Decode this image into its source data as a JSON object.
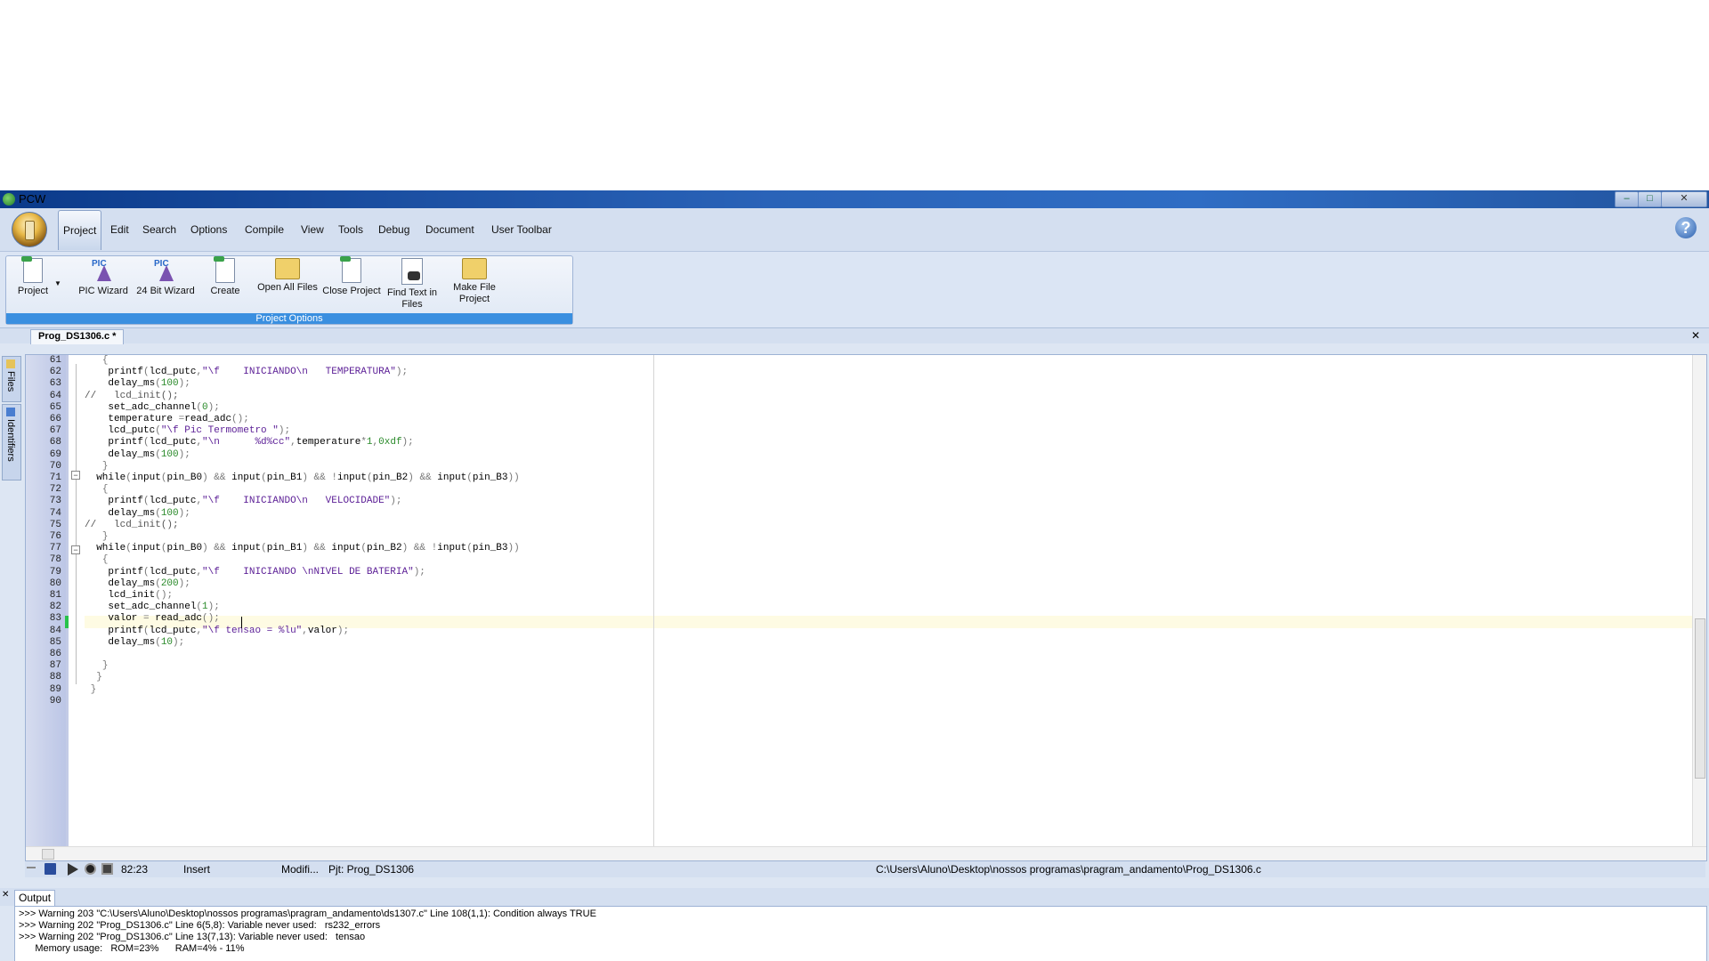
{
  "window": {
    "title": "PCW"
  },
  "menu": {
    "tabs": [
      "Project",
      "Edit",
      "Search",
      "Options",
      "Compile",
      "View",
      "Tools",
      "Debug",
      "Document",
      "User Toolbar"
    ]
  },
  "ribbon": {
    "group_label": "Project Options",
    "buttons": {
      "project": "Project",
      "pic_wizard": "PIC Wizard",
      "bit24_wizard": "24 Bit Wizard",
      "create": "Create",
      "open_all": "Open All Files",
      "close_project": "Close Project",
      "find_text_1": "Find Text in",
      "find_text_2": "Files",
      "make_file_1": "Make File",
      "make_file_2": "Project"
    },
    "pic_badge": "PIC"
  },
  "document": {
    "tab": "Prog_DS1306.c *"
  },
  "side_tabs": {
    "files": "Files",
    "identifiers": "Identifiers"
  },
  "editor": {
    "line_numbers": [
      "61",
      "62",
      "63",
      "64",
      "65",
      "66",
      "67",
      "68",
      "69",
      "70",
      "71",
      "72",
      "73",
      "74",
      "75",
      "76",
      "77",
      "78",
      "79",
      "80",
      "81",
      "82",
      "83",
      "84",
      "85",
      "86",
      "87",
      "88",
      "89",
      "90"
    ],
    "lines": [
      "   {",
      "    printf(lcd_putc,\"\\f    INICIANDO\\n   TEMPERATURA\");",
      "    delay_ms(100);",
      "//   lcd_init();",
      "    set_adc_channel(0);",
      "    temperature =read_adc();",
      "    lcd_putc(\"\\f Pic Termometro \");",
      "    printf(lcd_putc,\"\\n      %d%cc\",temperature*1,0xdf);",
      "    delay_ms(100);",
      "   }",
      "  while(input(pin_B0) && input(pin_B1) && !input(pin_B2) && input(pin_B3))",
      "   {",
      "    printf(lcd_putc,\"\\f    INICIANDO\\n   VELOCIDADE\");",
      "    delay_ms(100);",
      "//   lcd_init();",
      "   }",
      "  while(input(pin_B0) && input(pin_B1) && input(pin_B2) && !input(pin_B3))",
      "   {",
      "    printf(lcd_putc,\"\\f    INICIANDO \\nNIVEL DE BATERIA\");",
      "    delay_ms(200);",
      "    lcd_init();",
      "    set_adc_channel(1);",
      "    valor = read_adc();",
      "    printf(lcd_putc,\"\\f tensao = %lu\",valor);",
      "    delay_ms(10);",
      "",
      "   }",
      "  }",
      " }",
      ""
    ]
  },
  "status": {
    "position": "82:23",
    "mode": "Insert",
    "modified": "Modifi...",
    "project": "Pjt: Prog_DS1306",
    "path": "C:\\Users\\Aluno\\Desktop\\nossos programas\\pragram_andamento\\Prog_DS1306.c"
  },
  "output": {
    "tab": "Output",
    "lines": [
      ">>> Warning 203 \"C:\\Users\\Aluno\\Desktop\\nossos programas\\pragram_andamento\\ds1307.c\" Line 108(1,1): Condition always TRUE",
      ">>> Warning 202 \"Prog_DS1306.c\" Line 6(5,8): Variable never used:   rs232_errors",
      ">>> Warning 202 \"Prog_DS1306.c\" Line 13(7,13): Variable never used:   tensao",
      "      Memory usage:   ROM=23%      RAM=4% - 11%"
    ]
  }
}
